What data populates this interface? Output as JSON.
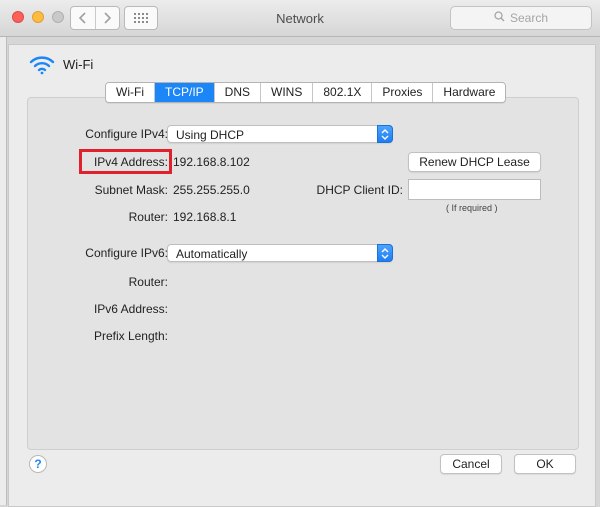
{
  "window": {
    "title": "Network"
  },
  "search": {
    "placeholder": "Search"
  },
  "service": {
    "name": "Wi-Fi"
  },
  "tabs": [
    "Wi-Fi",
    "TCP/IP",
    "DNS",
    "WINS",
    "802.1X",
    "Proxies",
    "Hardware"
  ],
  "active_tab": "TCP/IP",
  "ipv4": {
    "configure_label": "Configure IPv4:",
    "configure_value": "Using DHCP",
    "address_label": "IPv4 Address:",
    "address_value": "192.168.8.102",
    "subnet_label": "Subnet Mask:",
    "subnet_value": "255.255.255.0",
    "router_label": "Router:",
    "router_value": "192.168.8.1",
    "renew_button": "Renew DHCP Lease",
    "client_id_label": "DHCP Client ID:",
    "client_id_value": "",
    "client_id_hint": "( If required )"
  },
  "ipv6": {
    "configure_label": "Configure IPv6:",
    "configure_value": "Automatically",
    "router_label": "Router:",
    "address_label": "IPv6 Address:",
    "prefix_label": "Prefix Length:"
  },
  "footer": {
    "cancel": "Cancel",
    "ok": "OK",
    "help": "?"
  },
  "colors": {
    "accent": "#1d86f7",
    "highlight": "#e0202a"
  },
  "icons": {
    "close": "close-dot",
    "minimize": "minimize-dot",
    "zoom": "zoom-dot",
    "back": "chevron-left",
    "forward": "chevron-right",
    "grid": "grid-icon",
    "search": "magnifier",
    "wifi": "wifi-icon",
    "popup": "updown-arrows",
    "help": "question-mark"
  }
}
